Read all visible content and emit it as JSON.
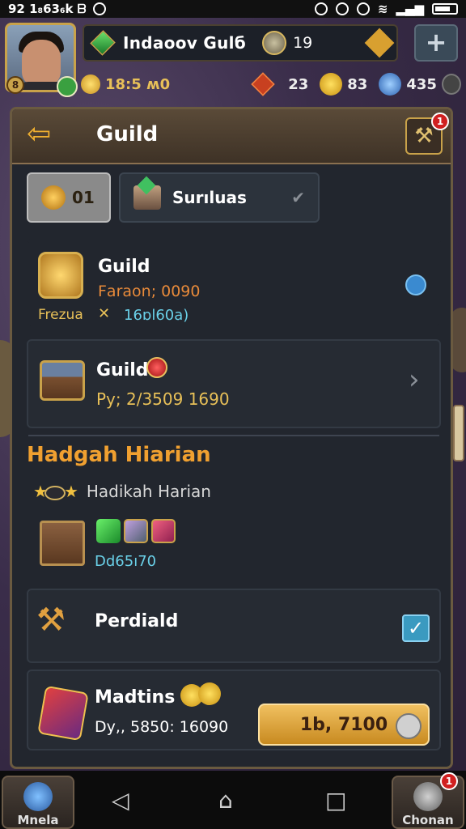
{
  "status_bar": {
    "left_text": "92  1₈63₆k ᗷ",
    "battery_label": "battery"
  },
  "hud": {
    "guild_name": "Indaoov Gulб",
    "guild_coin_value": "19",
    "level_badge": "8",
    "time_text": "18:5 ʍ0",
    "resources": [
      {
        "icon": "red-cube-icon",
        "value": "23"
      },
      {
        "icon": "gold-coin-icon",
        "value": "83"
      },
      {
        "icon": "blue-orb-icon",
        "value": "435"
      }
    ],
    "plus_label": "+"
  },
  "panel": {
    "title": "Guild",
    "back_label": "⇦",
    "notification_count": "1",
    "tabs": [
      {
        "label": "01",
        "active": true
      },
      {
        "label": "Surıluas",
        "active": false
      }
    ],
    "cards": [
      {
        "title": "Guild",
        "line1": "Fаraon; 0090",
        "line2_label": "Frezua",
        "line2_value": "16ɒl60a)"
      },
      {
        "title": "Guild",
        "line1": "Py; 2/3509  1690"
      }
    ],
    "section_title": "Hadgah Hiarian",
    "daily_label": "Hadikah Harian",
    "daily_code": "Dd65ı70",
    "perk_title": "Perdiald",
    "reward": {
      "title": "Madtins",
      "line": "Dy,, 5850:  16090",
      "button_label": "1b, 7100"
    }
  },
  "bottom_nav": {
    "left_label": "Mnela",
    "right_label": "Chonan",
    "right_badge": "1"
  },
  "colors": {
    "accent_gold": "#f0a030",
    "panel_bg": "#22262e",
    "button_gold": "#e8b040"
  }
}
